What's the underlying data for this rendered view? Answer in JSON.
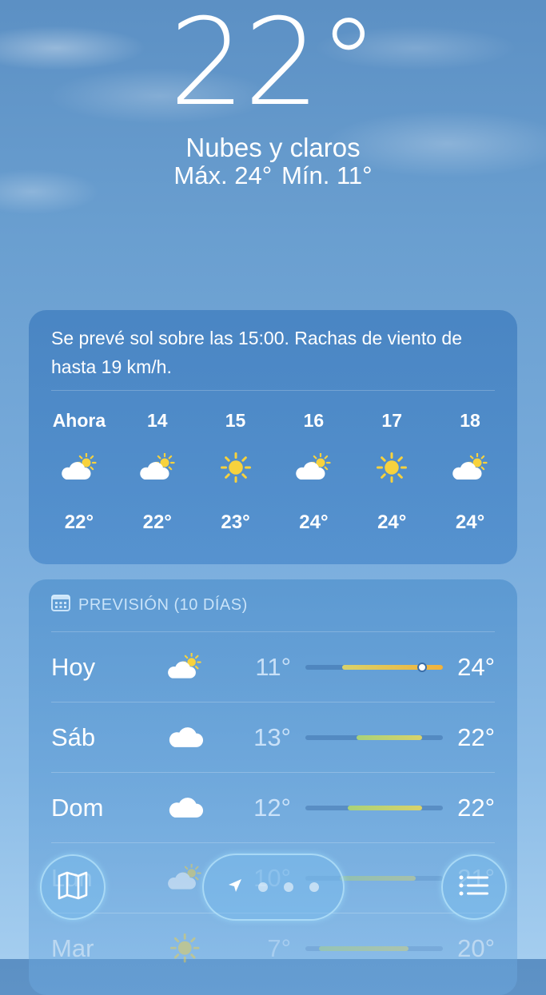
{
  "hero": {
    "temperature": "22°",
    "condition": "Nubes y claros",
    "high": "Máx. 24°",
    "low": "Mín. 11°"
  },
  "hourly": {
    "summary": "Se prevé sol sobre las 15:00. Rachas de viento de hasta 19 km/h.",
    "hours": [
      {
        "label": "Ahora",
        "icon": "partly-sunny-icon",
        "temp": "22°"
      },
      {
        "label": "14",
        "icon": "partly-sunny-icon",
        "temp": "22°"
      },
      {
        "label": "15",
        "icon": "sun-icon",
        "temp": "23°"
      },
      {
        "label": "16",
        "icon": "partly-sunny-icon",
        "temp": "24°"
      },
      {
        "label": "17",
        "icon": "sun-icon",
        "temp": "24°"
      },
      {
        "label": "18",
        "icon": "partly-sunny-icon",
        "temp": "24°"
      }
    ]
  },
  "forecast": {
    "header": "PREVISIÓN (10 DÍAS)",
    "days": [
      {
        "day": "Hoy",
        "icon": "partly-sunny-icon",
        "min": "11°",
        "max": "24°",
        "range_start": 0.27,
        "range_end": 1.0,
        "current": 0.84
      },
      {
        "day": "Sáb",
        "icon": "cloud-icon",
        "min": "13°",
        "max": "22°",
        "range_start": 0.37,
        "range_end": 0.85
      },
      {
        "day": "Dom",
        "icon": "cloud-icon",
        "min": "12°",
        "max": "22°",
        "range_start": 0.31,
        "range_end": 0.85
      },
      {
        "day": "Lun",
        "icon": "partly-sunny-icon",
        "min": "10°",
        "max": "21°",
        "range_start": 0.25,
        "range_end": 0.8
      },
      {
        "day": "Mar",
        "icon": "sun-icon",
        "min": "7°",
        "max": "20°",
        "range_start": 0.1,
        "range_end": 0.75
      }
    ]
  },
  "colors": {
    "bar_warm": "#f2b23a",
    "bar_mild": "#d9d26a",
    "bar_cool": "#a8d27a"
  },
  "toolbar": {
    "map_icon": "map-icon",
    "location_icon": "location-arrow-icon",
    "list_icon": "list-icon"
  }
}
